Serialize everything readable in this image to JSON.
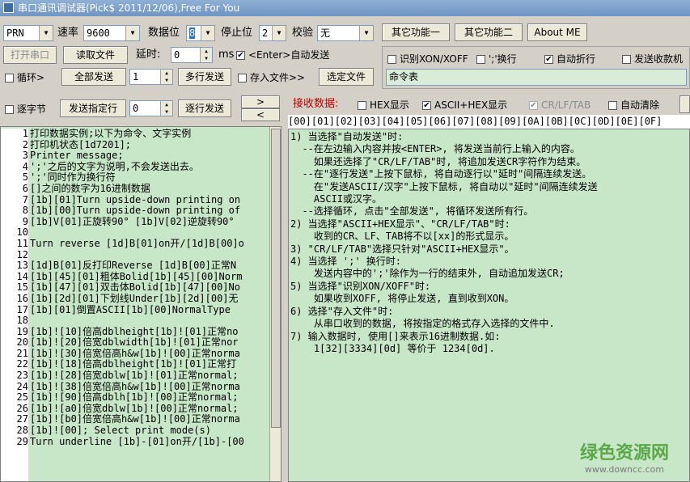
{
  "window": {
    "title": "串口通讯调试器(Pick$ 2011/12/06),Free For You"
  },
  "toolbar1": {
    "port_value": "PRN",
    "baud_label": "速率",
    "baud_value": "9600",
    "databits_label": "数据位",
    "databits_value": "8",
    "stopbits_label": "停止位",
    "stopbits_value": "2",
    "parity_label": "校验",
    "parity_value": "无",
    "other1_label": "其它功能一",
    "other2_label": "其它功能二",
    "about_label": "About ME"
  },
  "toolbar2": {
    "open_port_label": "打开串口",
    "read_file_label": "读取文件",
    "delay_label": "延时:",
    "delay_value": "0",
    "delay_unit": "ms",
    "enter_autosend_label": "<Enter>自动发送",
    "enter_autosend_checked": "✔"
  },
  "options": {
    "xon_label": "识别XON/XOFF",
    "semicolon_label": "';'换行",
    "autowrap_label": "自动折行",
    "autowrap_checked": "✔",
    "send_log_label": "发送收款机"
  },
  "toolbar3": {
    "loop_label": "循环>",
    "send_all_label": "全部发送",
    "loop_value": "1",
    "multi_send_label": "多行发送",
    "save_file_label": "存入文件>>",
    "choose_file_label": "选定文件",
    "command_table_value": "命令表"
  },
  "toolbar4": {
    "byte_by_byte_label": "逐字节",
    "send_specified_label": "发送指定行",
    "line_value": "0",
    "line_by_line_label": "逐行发送",
    "arrow_right": ">",
    "arrow_left": "<"
  },
  "receive_bar": {
    "receive_label": "接收数据:",
    "hex_display_label": "HEX显示",
    "ascii_hex_label": "ASCII+HEX显示",
    "ascii_hex_checked": "✔",
    "crlftab_label": "CR/LF/TAB",
    "crlftab_checked": "✔",
    "auto_clear_label": "自动清除"
  },
  "hex_header": "[00][01][02][03][04][05][06][07][08][09][0A][0B][0C][0D][0E][0F]",
  "left_lines": [
    {
      "n": "1",
      "t": "打印数据实例;以下为命令、文字实例"
    },
    {
      "n": "2",
      "t": "打印机状态[1d7201];"
    },
    {
      "n": "3",
      "t": "Printer message;"
    },
    {
      "n": "4",
      "t": "';'之后的文字为说明,不会发送出去。"
    },
    {
      "n": "5",
      "t": "';'同时作为换行符"
    },
    {
      "n": "6",
      "t": "[]之间的数字为16进制数据"
    },
    {
      "n": "7",
      "t": "[1b][01]Turn upside-down printing on"
    },
    {
      "n": "8",
      "t": "[1b][00]Turn upside-down printing of"
    },
    {
      "n": "9",
      "t": "[1b]V[01]正旋转90° [1b]V[02]逆旋转90°"
    },
    {
      "n": "10",
      "t": ""
    },
    {
      "n": "11",
      "t": "Turn reverse [1d]B[01]on开/[1d]B[00]o"
    },
    {
      "n": "12",
      "t": ""
    },
    {
      "n": "13",
      "t": "[1d]B[01]反打印Reverse [1d]B[00]正常N"
    },
    {
      "n": "14",
      "t": "[1b][45][01]粗体Bolid[1b][45][00]Norm"
    },
    {
      "n": "15",
      "t": "[1b][47][01]双击体Bolid[1b][47][00]No"
    },
    {
      "n": "16",
      "t": "[1b][2d][01]下划线Under[1b][2d][00]无"
    },
    {
      "n": "17",
      "t": "[1b][01]倒置ASCII[1b][00]NormalType"
    },
    {
      "n": "18",
      "t": ""
    },
    {
      "n": "19",
      "t": "[1b]![10]倍高dblheight[1b]![01]正常no"
    },
    {
      "n": "20",
      "t": "[1b]![20]倍宽dblwidth[1b]![01]正常nor"
    },
    {
      "n": "21",
      "t": "[1b]![30]倍宽倍高h&w[1b]![00]正常norma"
    },
    {
      "n": "22",
      "t": "[1b]![18]倍高dblheight[1b]![01]正常打"
    },
    {
      "n": "23",
      "t": "[1b]![28]倍宽dblw[1b]![01]正常normal;"
    },
    {
      "n": "24",
      "t": "[1b]![38]倍宽倍高h&w[1b]![00]正常norma"
    },
    {
      "n": "25",
      "t": "[1b]![90]倍高dblh[1b]![00]正常normal;"
    },
    {
      "n": "26",
      "t": "[1b]![a0]倍宽dblw[1b]![00]正常normal;"
    },
    {
      "n": "27",
      "t": "[1b]![b0]倍宽倍高h&w[1b]![00]正常norma"
    },
    {
      "n": "28",
      "t": "[1b]![00]; Select print mode(s)"
    },
    {
      "n": "29",
      "t": "Turn underline [1b]-[01]on开/[1b]-[00"
    }
  ],
  "right_lines": [
    "1) 当选择\"自动发送\"时:",
    "  --在左边输入内容并按<ENTER>, 将发送当前行上输入的内容。",
    "    如果还选择了\"CR/LF/TAB\"时, 将追加发送CR字符作为结束。",
    "  --在\"逐行发送\"上按下鼠标, 将自动逐行以\"延时\"间隔连续发送。",
    "    在\"发送ASCII/汉字\"上按下鼠标, 将自动以\"延时\"间隔连续发送",
    "    ASCII或汉字。",
    "  --选择循环, 点击\"全部发送\", 将循环发送所有行。",
    "2) 当选择\"ASCII+HEX显示\"、\"CR/LF/TAB\"时:",
    "    收到的CR、LF、TAB将不以[xx]的形式显示。",
    "3) \"CR/LF/TAB\"选择只针对\"ASCII+HEX显示\"。",
    "4) 当选择 ';' 换行时:",
    "    发送内容中的';'除作为一行的结束外, 自动追加发送CR;",
    "5) 当选择\"识别XON/XOFF\"时:",
    "    如果收到XOFF, 将停止发送, 直到收到XON。",
    "6) 选择\"存入文件\"时:",
    "    从串口收到的数据, 将按指定的格式存入选择的文件中.",
    "7) 输入数据时, 使用[]来表示16进制数据.如:",
    "    1[32][3334][0d] 等价于 1234[0d]."
  ],
  "watermark": {
    "brand": "绿色资源网",
    "url": "www.downcc.com"
  }
}
